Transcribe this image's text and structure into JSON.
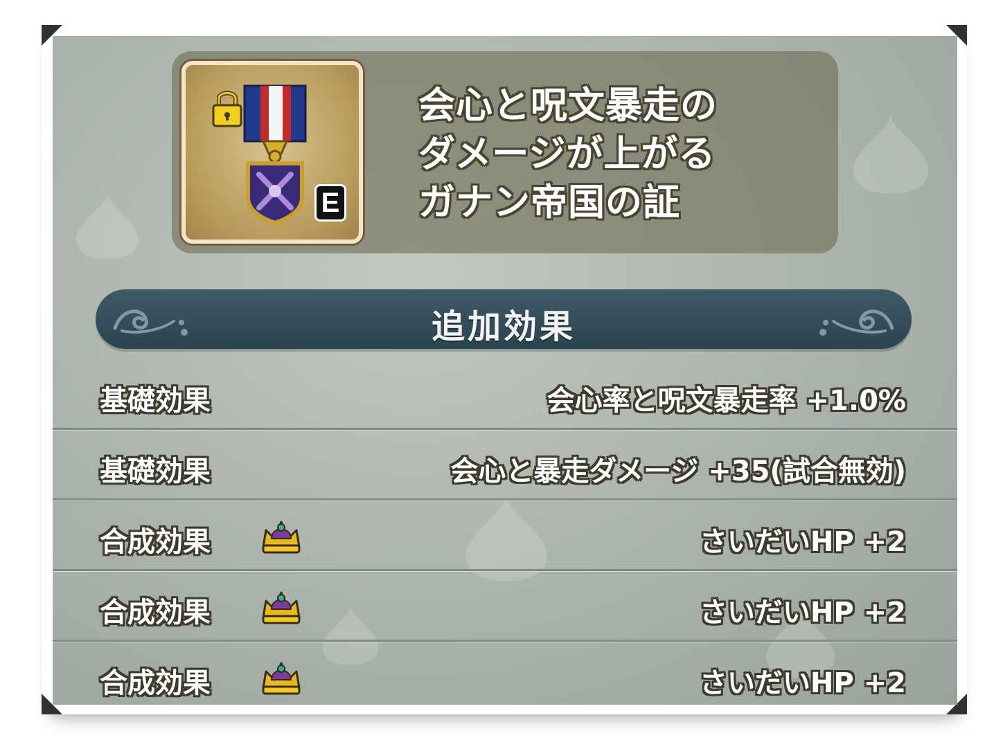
{
  "item": {
    "name_lines": [
      "会心と呪文暴走の",
      "ダメージが上がる",
      "ガナン帝国の証"
    ],
    "equipped_badge": "E",
    "locked": true,
    "icon": "medal-icon"
  },
  "section": {
    "title": "追加効果"
  },
  "effects": [
    {
      "label": "基礎効果",
      "value": "会心率と呪文暴走率 +1.0%",
      "icon": ""
    },
    {
      "label": "基礎効果",
      "value": "会心と暴走ダメージ +35(試合無効)",
      "icon": ""
    },
    {
      "label": "合成効果",
      "value": "さいだいHP +2",
      "icon": "crown-icon"
    },
    {
      "label": "合成効果",
      "value": "さいだいHP +2",
      "icon": "crown-icon"
    },
    {
      "label": "合成効果",
      "value": "さいだいHP +2",
      "icon": "crown-icon"
    }
  ],
  "colors": {
    "panel_bg": "#aab3ab",
    "section_bar": "#2f4a56",
    "ribbon_blue": "#223a8c",
    "ribbon_white": "#f4f4f4",
    "crown_gold": "#e8b820",
    "crown_purple": "#7a3c9a"
  }
}
